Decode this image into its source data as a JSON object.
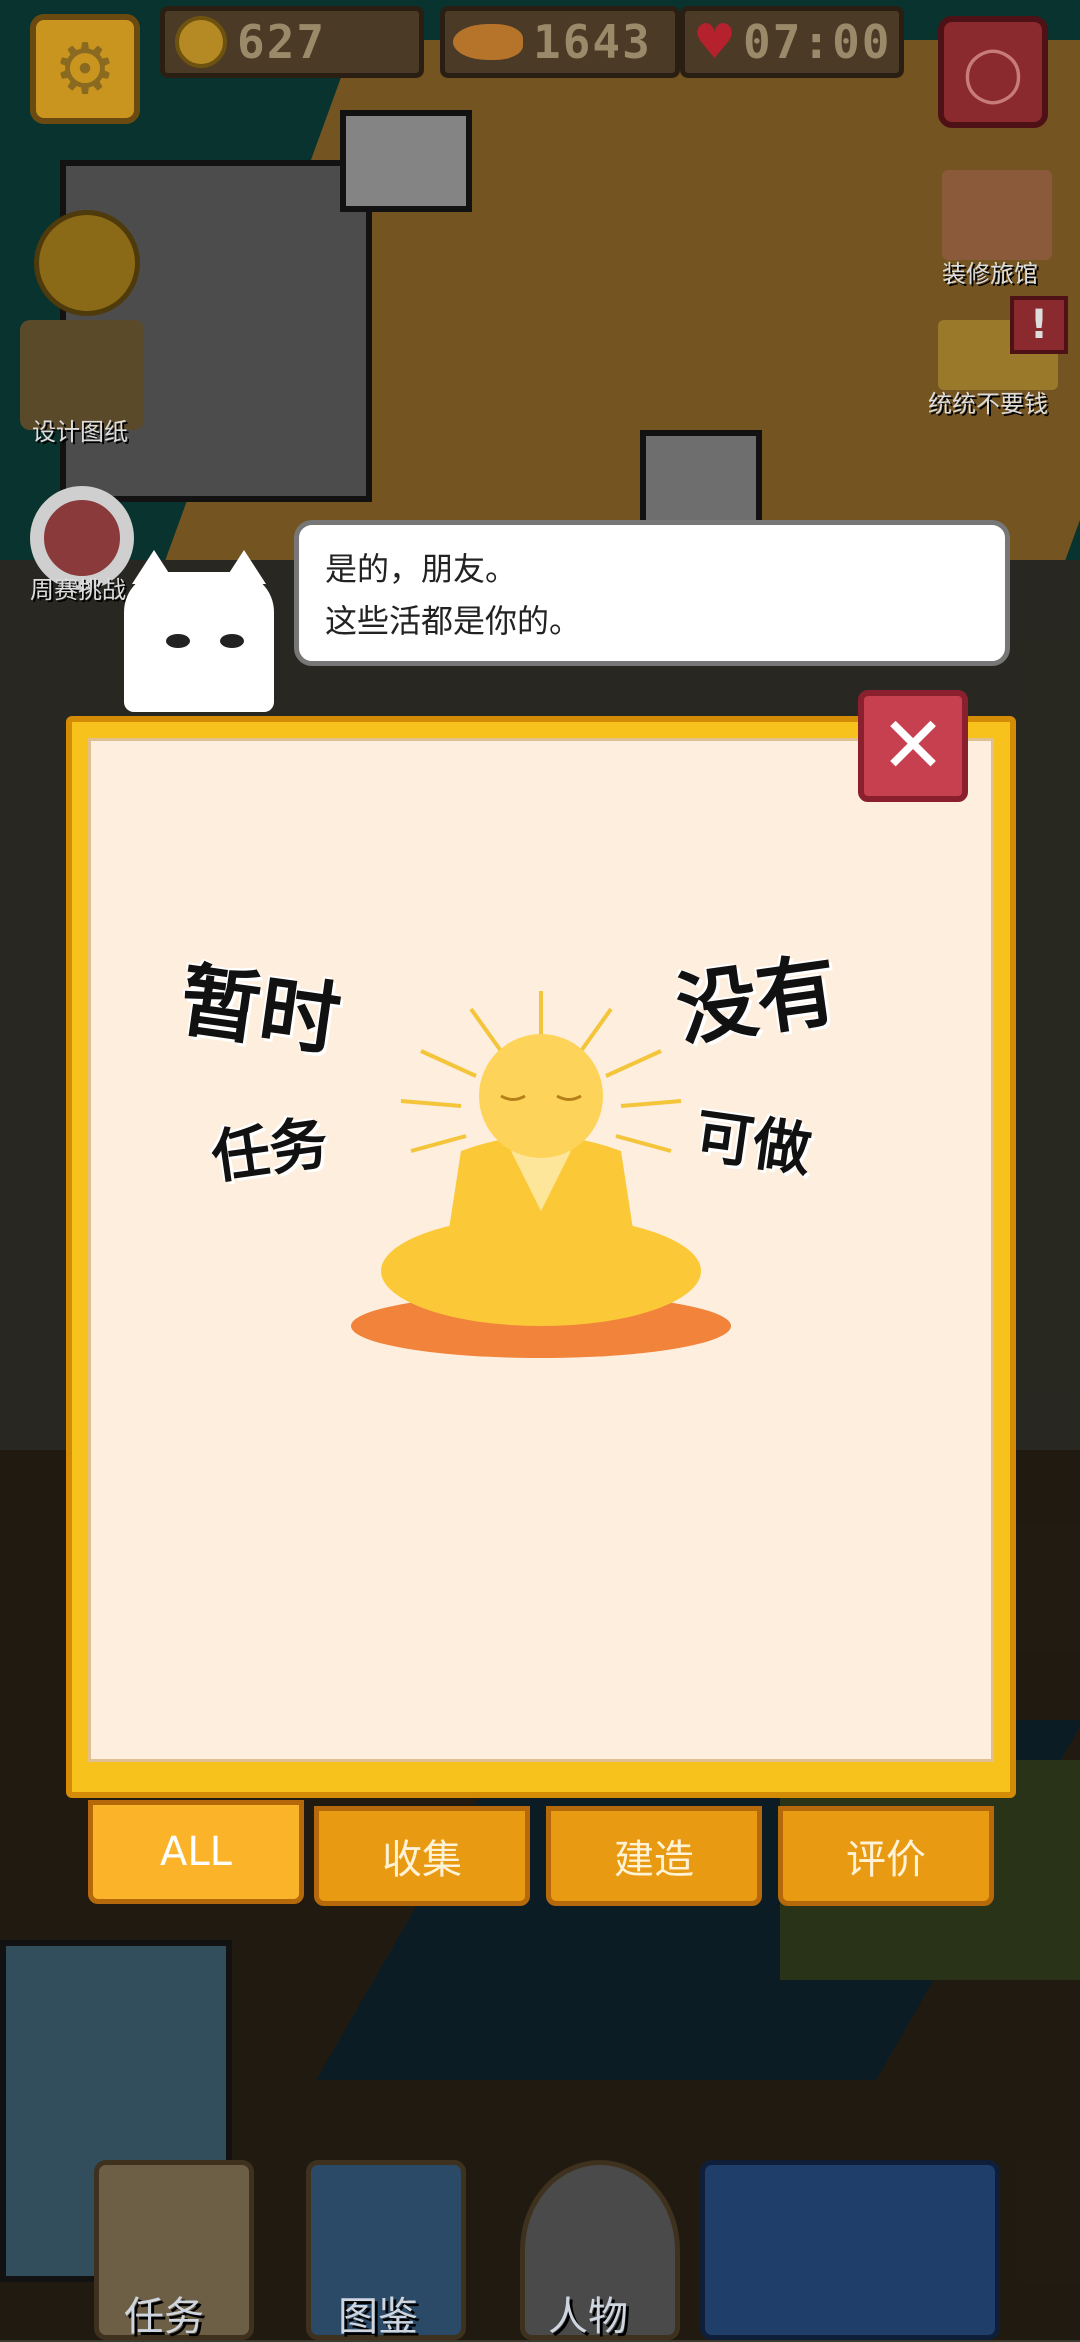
{
  "top_bar": {
    "coins": "627",
    "fish": "1643",
    "timer": "07:00",
    "coin_icon": "gold-coin-icon",
    "fish_icon": "fish-icon",
    "heart_icon": "heart-icon"
  },
  "side_menu": {
    "settings_icon": "gear-icon",
    "hint_icon": "lightbulb-icon",
    "renovate_label": "装修旅馆",
    "no_money_label": "统统不要钱",
    "design_label": "设计图纸",
    "weekly_label": "周赛挑战"
  },
  "dialog": {
    "line1": "是的，朋友。",
    "line2": "这些活都是你的。"
  },
  "panel": {
    "close_icon": "close-icon",
    "empty_text_1": "暂时",
    "empty_text_2": "没有",
    "empty_text_3": "任务",
    "empty_text_4": "可做",
    "tabs": [
      {
        "label": "ALL",
        "active": true
      },
      {
        "label": "收集",
        "active": false
      },
      {
        "label": "建造",
        "active": false
      },
      {
        "label": "评价",
        "active": false
      }
    ]
  },
  "bottom_bar": {
    "tasks": "任务",
    "catalog": "图鉴",
    "characters": "人物"
  },
  "colors": {
    "panel_yellow": "#f7c21c",
    "panel_bg": "#fdeedd",
    "close_red": "#c7404f",
    "tab_orange": "#e89a13"
  }
}
